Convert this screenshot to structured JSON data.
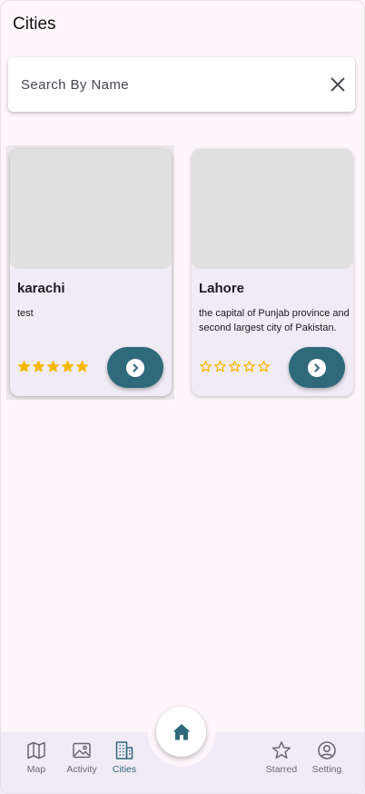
{
  "header": {
    "title": "Cities"
  },
  "search": {
    "placeholder": "Search By Name",
    "value": "",
    "clear_icon": "close-icon"
  },
  "cities": [
    {
      "name": "karachi",
      "description": "test",
      "rating": 5,
      "max_rating": 5,
      "action_icon": "chevron-right-icon"
    },
    {
      "name": "Lahore",
      "description": "the capital of Punjab province and second largest city of Pakistan.",
      "rating": 0,
      "max_rating": 5,
      "action_icon": "chevron-right-icon"
    }
  ],
  "bottom_nav": {
    "items": [
      {
        "label": "Map",
        "icon": "map-icon",
        "active": false
      },
      {
        "label": "Activity",
        "icon": "image-icon",
        "active": false
      },
      {
        "label": "Cities",
        "icon": "buildings-icon",
        "active": true
      },
      {
        "label": "Starred",
        "icon": "star-icon",
        "active": false
      },
      {
        "label": "Setting",
        "icon": "account-icon",
        "active": false
      }
    ],
    "fab_icon": "home-icon"
  },
  "colors": {
    "accent": "#2f6a7b",
    "star": "#f5b800",
    "background": "#fdf7fc",
    "card": "#f0ebf4"
  }
}
